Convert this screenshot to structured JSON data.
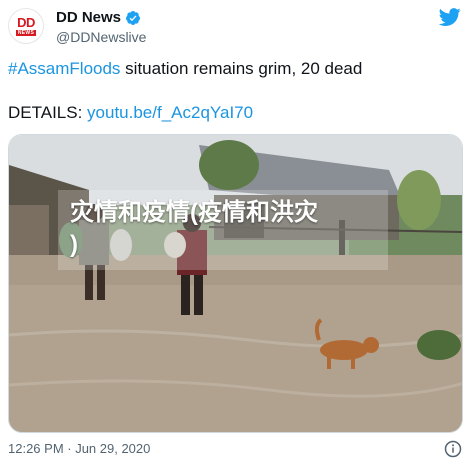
{
  "account": {
    "logo_text": "DD",
    "logo_subtext": "NEWS",
    "name": "DD News",
    "handle": "@DDNewslive"
  },
  "tweet": {
    "hashtag": "#AssamFloods",
    "body": " situation remains grim, 20 dead",
    "details_label": "DETAILS: ",
    "link": "youtu.be/f_Ac2qYaI70"
  },
  "overlay": {
    "line1": "灾情和疫情(疫情和洪灾",
    "line2": ")"
  },
  "meta": {
    "timestamp": "12:26 PM · Jun 29, 2020"
  },
  "colors": {
    "link": "#1b95e0",
    "brand_red": "#d71920",
    "twitter_blue": "#1da1f2"
  },
  "icons": [
    "verified-badge-icon",
    "twitter-bird-icon",
    "info-icon"
  ]
}
